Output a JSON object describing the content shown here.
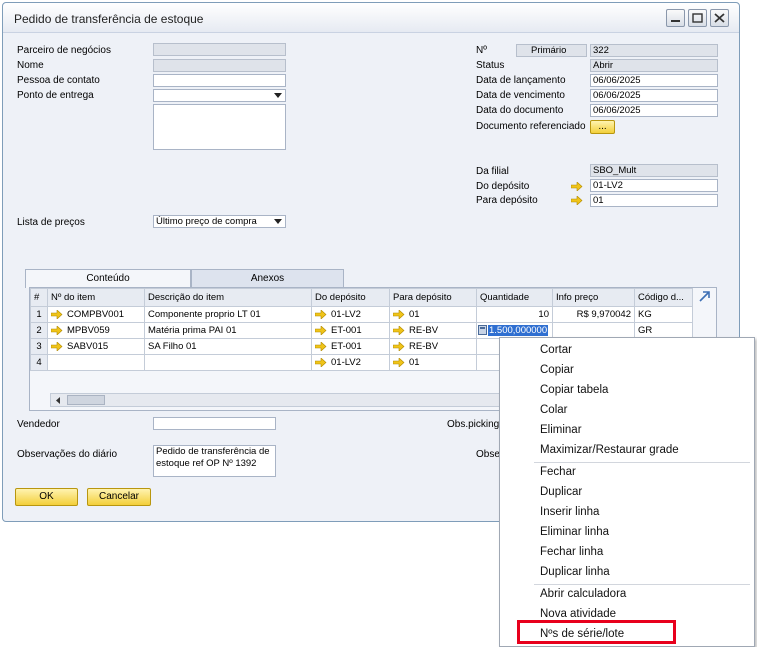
{
  "window": {
    "title": "Pedido de transferência de estoque"
  },
  "left_fields": {
    "parceiro_label": "Parceiro de negócios",
    "nome_label": "Nome",
    "contato_label": "Pessoa de contato",
    "ponto_label": "Ponto de entrega",
    "lista_label": "Lista de preços",
    "lista_value": "Último preço de compra"
  },
  "right_fields": {
    "no_label": "Nº",
    "series_value": "Primário",
    "number_value": "322",
    "status_label": "Status",
    "status_value": "Abrir",
    "lancamento_label": "Data de lançamento",
    "lancamento_value": "06/06/2025",
    "vencimento_label": "Data de vencimento",
    "vencimento_value": "06/06/2025",
    "documento_label": "Data do documento",
    "documento_value": "06/06/2025",
    "docref_label": "Documento referenciado",
    "docref_button": "...",
    "filial_label": "Da filial",
    "filial_value": "SBO_Mult",
    "do_deposito_label": "Do depósito",
    "do_deposito_value": "01-LV2",
    "para_deposito_label": "Para depósito",
    "para_deposito_value": "01"
  },
  "tabs": [
    "Conteúdo",
    "Anexos"
  ],
  "grid": {
    "columns": [
      "#",
      "Nº do item",
      "Descrição do item",
      "Do depósito",
      "Para depósito",
      "Quantidade",
      "Info preço",
      "Código d..."
    ],
    "rows": [
      {
        "n": "1",
        "item": "COMPBV001",
        "desc": "Componente proprio LT 01",
        "from": "01-LV2",
        "to": "01",
        "qty": "10",
        "price": "R$ 9,970042",
        "code": "KG"
      },
      {
        "n": "2",
        "item": "MPBV059",
        "desc": "Matéria prima PAI 01",
        "from": "ET-001",
        "to": "RE-BV",
        "qty": "1.500,000000",
        "price": "",
        "code": "GR"
      },
      {
        "n": "3",
        "item": "SABV015",
        "desc": "SA Filho 01",
        "from": "ET-001",
        "to": "RE-BV",
        "qty": "",
        "price": "",
        "code": ""
      },
      {
        "n": "4",
        "item": "",
        "desc": "",
        "from": "01-LV2",
        "to": "01",
        "qty": "",
        "price": "",
        "code": ""
      }
    ]
  },
  "bottom": {
    "vendedor_label": "Vendedor",
    "obs_picking_label": "Obs.picking",
    "obs_diario_label": "Observações do diário",
    "obs_diario_value": "Pedido de transferência de estoque ref OP Nº 1392",
    "obs_right_label": "Obse",
    "ok_button": "OK",
    "cancel_button": "Cancelar"
  },
  "context_menu": {
    "group1": [
      "Cortar",
      "Copiar",
      "Copiar tabela",
      "Colar",
      "Eliminar",
      "Maximizar/Restaurar grade"
    ],
    "group2": [
      "Fechar",
      "Duplicar",
      "Inserir linha",
      "Eliminar linha",
      "Fechar linha",
      "Duplicar linha"
    ],
    "group3": [
      "Abrir calculadora",
      "Nova atividade",
      "Nºs de série/lote"
    ]
  },
  "colors": {
    "highlight": "#e8001c",
    "arrow": "#f0c419",
    "button": "#f3cf3a"
  }
}
